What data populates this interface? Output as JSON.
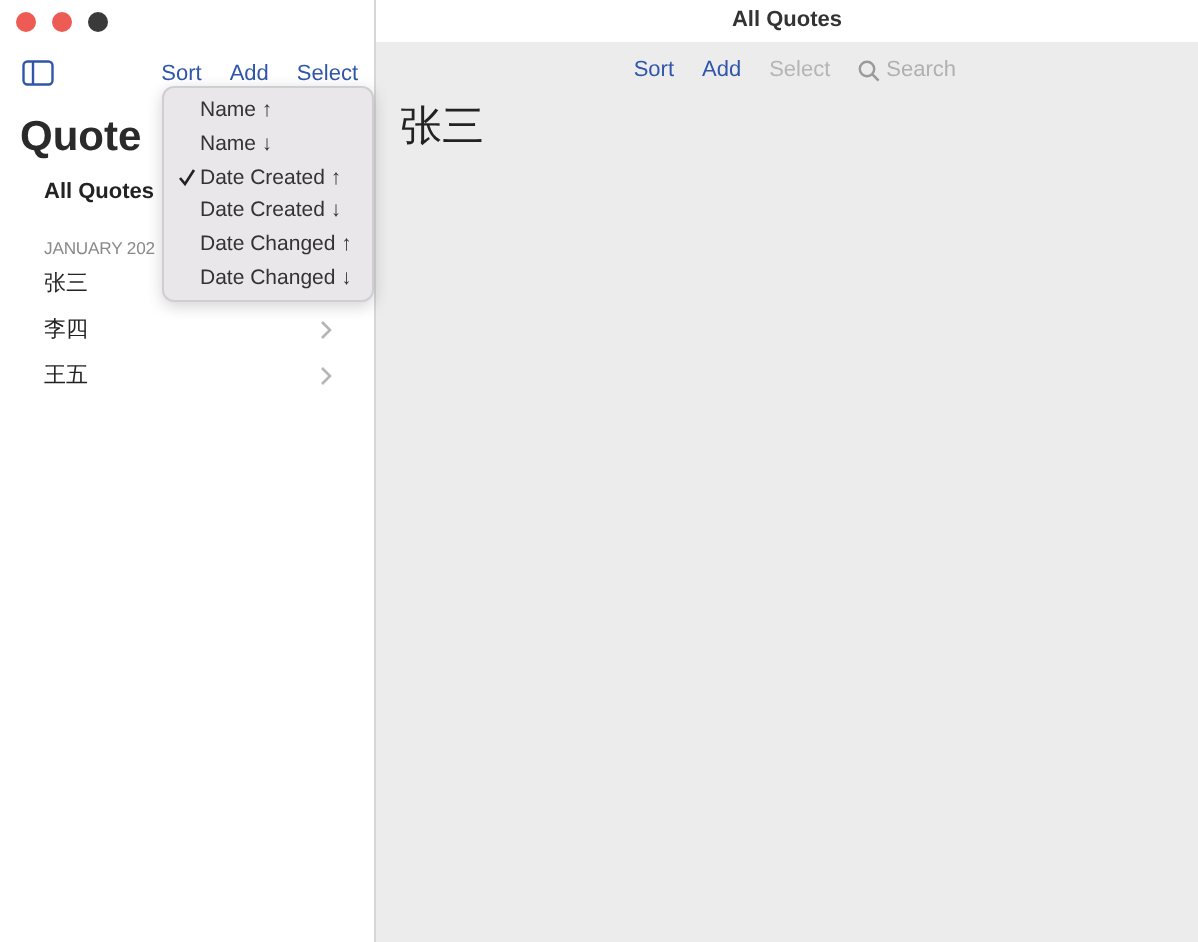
{
  "sidebar": {
    "toolbar": [
      {
        "label": "Sort",
        "disabled": false
      },
      {
        "label": "Add",
        "disabled": false
      },
      {
        "label": "Select",
        "disabled": false
      }
    ],
    "title": "Quote",
    "all_item": "All Quotes",
    "section": "JANUARY 202",
    "rows": [
      {
        "label": "张三"
      },
      {
        "label": "李四"
      },
      {
        "label": "王五"
      }
    ]
  },
  "sort_menu": [
    {
      "label": "Name ↑",
      "selected": false
    },
    {
      "label": "Name ↓",
      "selected": false
    },
    {
      "label": "Date Created ↑",
      "selected": true
    },
    {
      "label": "Date Created ↓",
      "selected": false
    },
    {
      "label": "Date Changed ↑",
      "selected": false
    },
    {
      "label": "Date Changed ↓",
      "selected": false
    }
  ],
  "detail": {
    "window_title": "All Quotes",
    "toolbar": [
      {
        "label": "Sort",
        "disabled": false
      },
      {
        "label": "Add",
        "disabled": false
      },
      {
        "label": "Select",
        "disabled": true
      }
    ],
    "search": {
      "placeholder": "Search"
    },
    "heading": "张三"
  }
}
